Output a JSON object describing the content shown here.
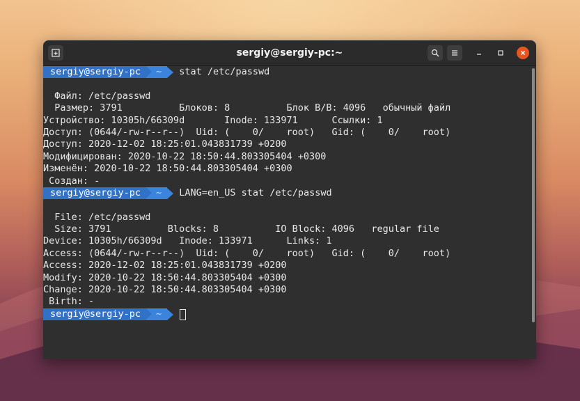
{
  "window": {
    "title": "sergiy@sergiy-pc:~"
  },
  "titlebar": {
    "new_tab_icon": "new-tab-icon",
    "search_icon": "search-icon",
    "menu_icon": "hamburger-menu-icon",
    "minimize_icon": "minimize-icon",
    "maximize_icon": "maximize-icon",
    "close_icon": "close-icon",
    "close_color": "#e95420"
  },
  "prompt": {
    "user_host": "sergiy@sergiy-pc",
    "dir": "~",
    "user_bg": "#3272c6",
    "dir_bg": "#3a84dd"
  },
  "session": [
    {
      "command": "stat /etc/passwd",
      "output": [
        "",
        "  Файл: /etc/passwd",
        "  Размер: 3791          Блоков: 8          Блок В/В: 4096   обычный файл",
        "Устройство: 10305h/66309d       Inode: 133971      Ссылки: 1",
        "Доступ: (0644/-rw-r--r--)  Uid: (    0/    root)   Gid: (    0/    root)",
        "Доступ: 2020-12-02 18:25:01.043831739 +0200",
        "Модифицирован: 2020-10-22 18:50:44.803305404 +0300",
        "Изменён: 2020-10-22 18:50:44.803305404 +0300",
        " Создан: -"
      ]
    },
    {
      "command": "LANG=en_US stat /etc/passwd",
      "output": [
        "",
        "  File: /etc/passwd",
        "  Size: 3791          Blocks: 8          IO Block: 4096   regular file",
        "Device: 10305h/66309d   Inode: 133971      Links: 1",
        "Access: (0644/-rw-r--r--)  Uid: (    0/    root)   Gid: (    0/    root)",
        "Access: 2020-12-02 18:25:01.043831739 +0200",
        "Modify: 2020-10-22 18:50:44.803305404 +0300",
        "Change: 2020-10-22 18:50:44.803305404 +0300",
        " Birth: -"
      ]
    }
  ],
  "current_command": ""
}
